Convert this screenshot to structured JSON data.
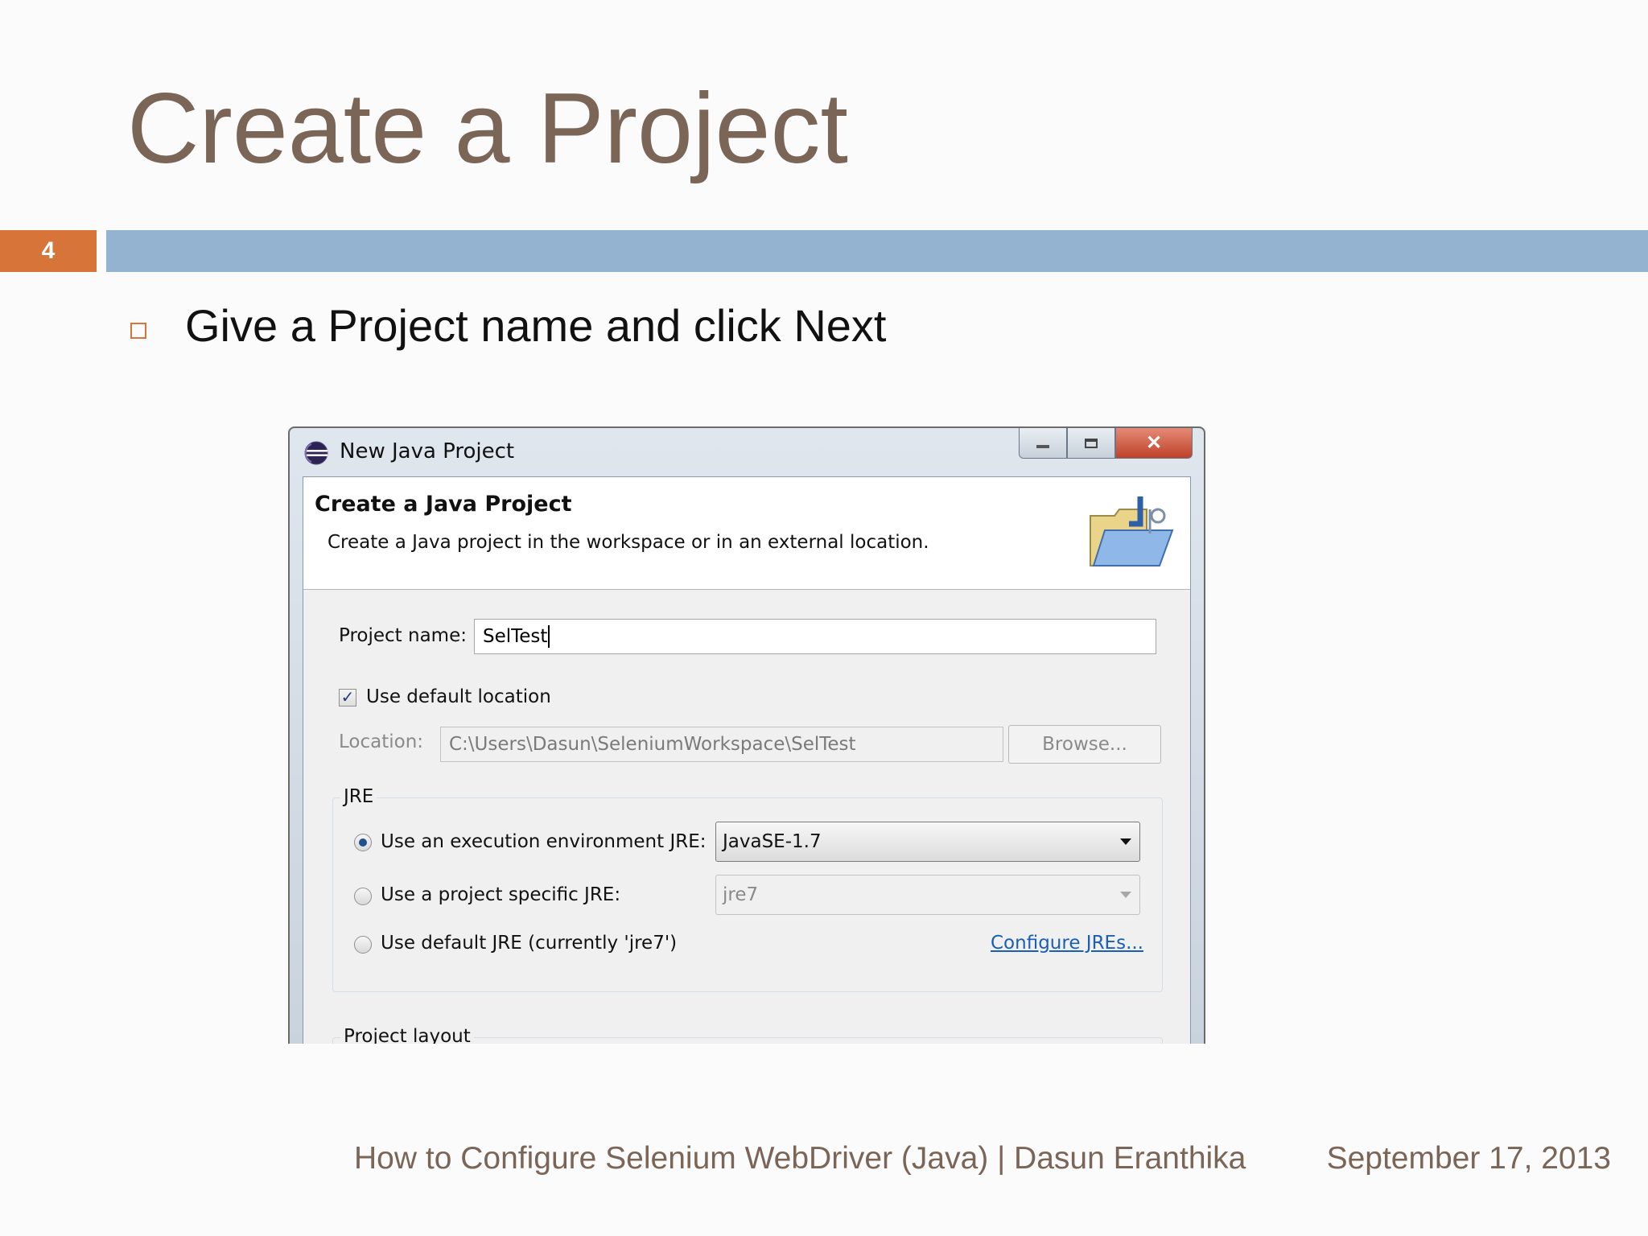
{
  "slide": {
    "title": "Create a Project",
    "number": "4",
    "bullet": "Give a Project name and click Next",
    "footer_left": "How to Configure Selenium WebDriver (Java) | Dasun Eranthika",
    "footer_date": "September 17, 2013",
    "colors": {
      "title": "#7a6557",
      "number_box": "#d6743a",
      "bar": "#94b3d0"
    }
  },
  "dialog": {
    "window_title": "New Java Project",
    "window_icon": "eclipse-icon",
    "header_title": "Create a Java Project",
    "header_desc": "Create a Java project in the workspace or in an external location.",
    "header_icon": "java-folder-icon",
    "project_name_label": "Project name:",
    "project_name_value": "SelTest",
    "use_default_location_label": "Use default location",
    "use_default_location_checked": true,
    "location_label": "Location:",
    "location_value": "C:\\Users\\Dasun\\SeleniumWorkspace\\SelTest",
    "browse_label": "Browse...",
    "jre_group_label": "JRE",
    "jre_options": [
      {
        "label": "Use an execution environment JRE:",
        "selected": true,
        "combo_value": "JavaSE-1.7"
      },
      {
        "label": "Use a project specific JRE:",
        "selected": false,
        "combo_value": "jre7"
      },
      {
        "label": "Use default JRE (currently 'jre7')",
        "selected": false
      }
    ],
    "configure_jres_label": "Configure JREs...",
    "project_layout_label": "Project layout"
  }
}
